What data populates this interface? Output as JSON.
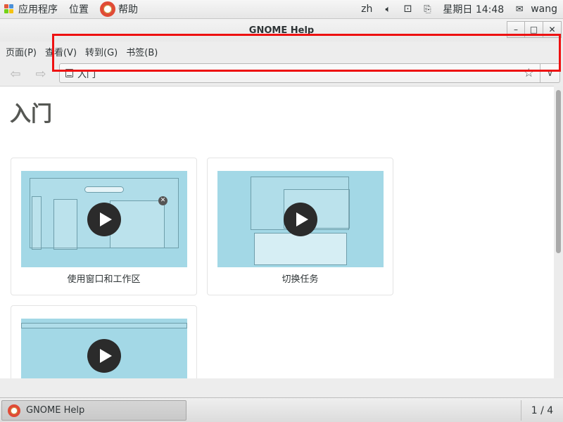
{
  "top_panel": {
    "applications": "应用程序",
    "places": "位置",
    "help": "帮助",
    "input_method": "zh",
    "clock": "星期日 14:48",
    "user": "wang"
  },
  "window": {
    "title": "GNOME Help",
    "menu": [
      "页面(P)",
      "查看(V)",
      "转到(G)",
      "书签(B)"
    ],
    "location": "入门"
  },
  "page": {
    "title": "入门",
    "cards": [
      {
        "label": "使用窗口和工作区"
      },
      {
        "label": "切换任务"
      },
      {
        "label": ""
      }
    ]
  },
  "taskbar": {
    "task_label": "GNOME Help",
    "workspace": "1 / 4"
  },
  "colors": {
    "highlight": "#ee1111",
    "thumb_bg": "#a3d8e6"
  }
}
